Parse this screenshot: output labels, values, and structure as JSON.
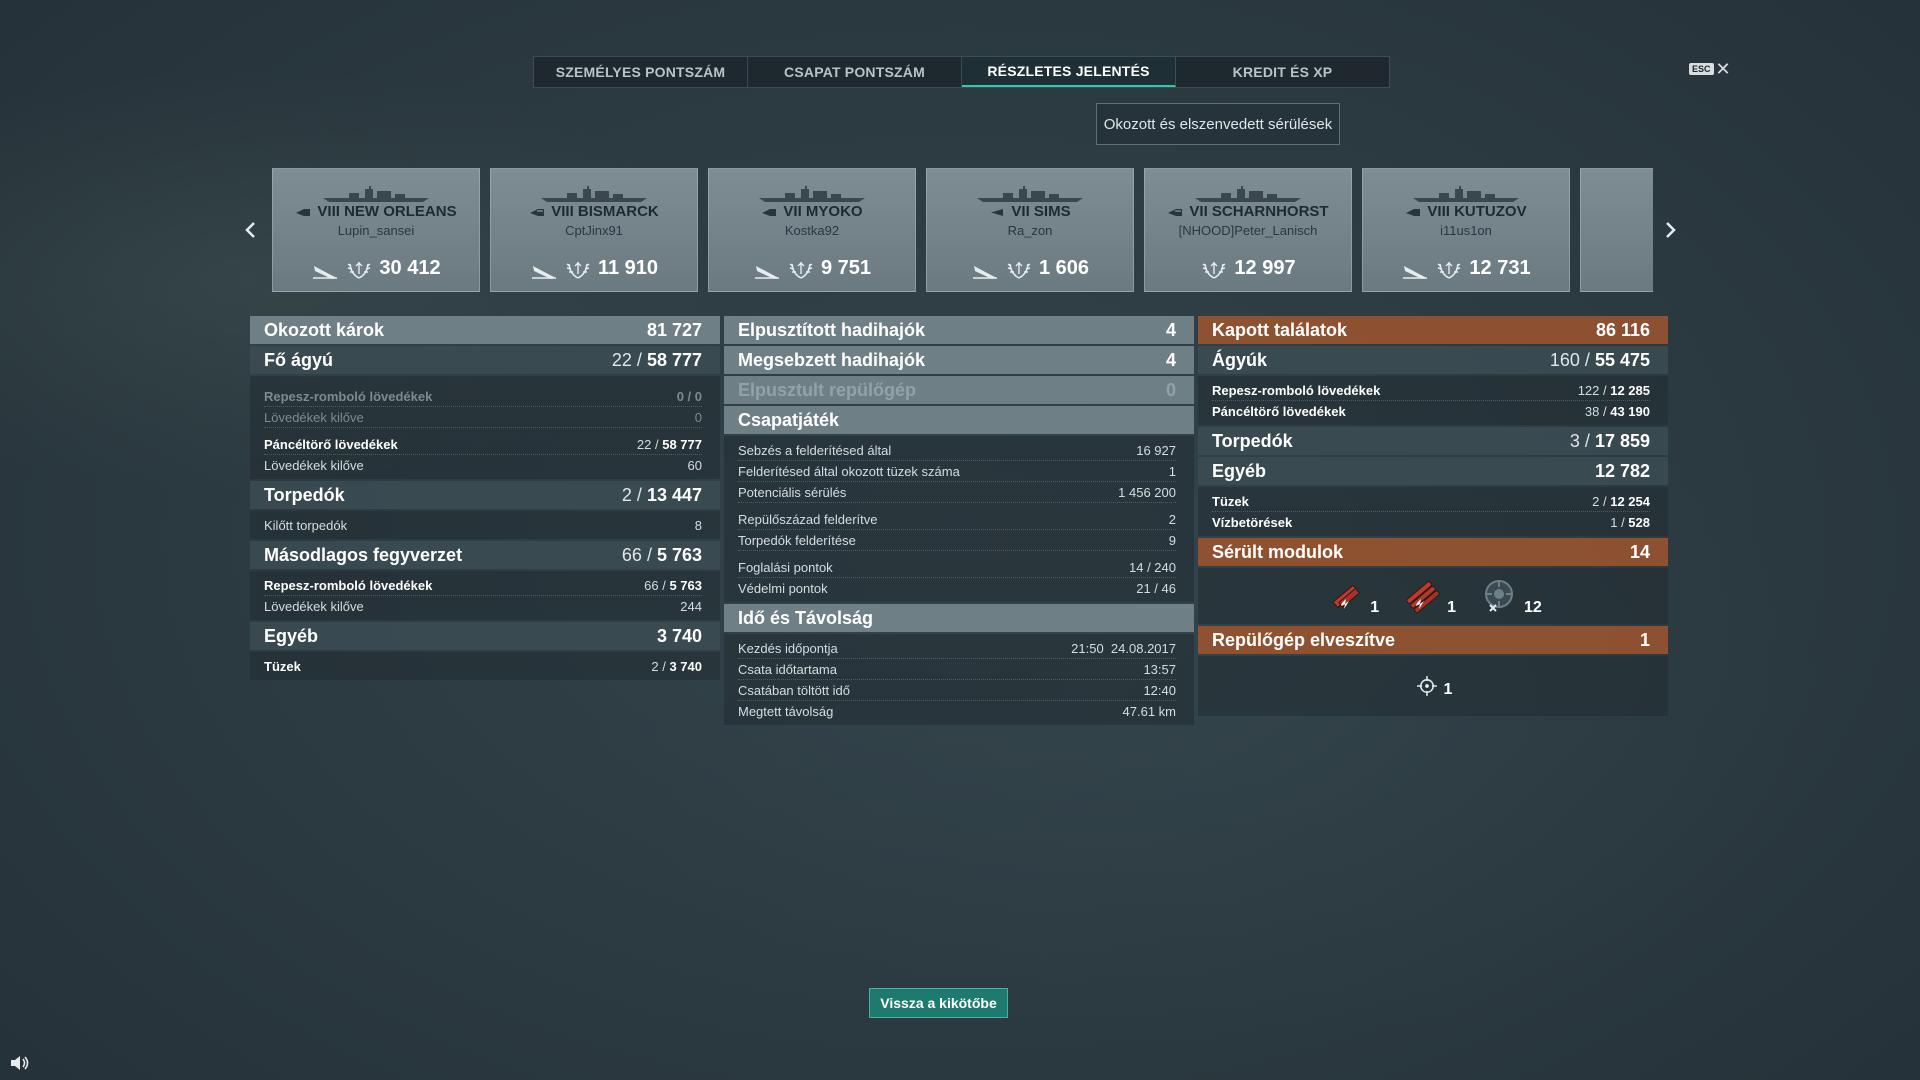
{
  "tabs": [
    "SZEMÉLYES PONTSZÁM",
    "CSAPAT PONTSZÁM",
    "RÉSZLETES JELENTÉS",
    "KREDIT ÉS XP"
  ],
  "active_tab": 2,
  "esc_label": "ESC",
  "damage_filter_button": "Okozott és elszenvedett sérülések",
  "ships": [
    {
      "name": "VIII NEW ORLEANS",
      "player": "Lupin_sansei",
      "score": "30 412",
      "type": "cruiser"
    },
    {
      "name": "VIII BISMARCK",
      "player": "CptJinx91",
      "score": "11 910",
      "type": "battleship"
    },
    {
      "name": "VII MYOKO",
      "player": "Kostka92",
      "score": "9 751",
      "type": "cruiser"
    },
    {
      "name": "VII SIMS",
      "player": "Ra_zon",
      "score": "1 606",
      "type": "destroyer"
    },
    {
      "name": "VII SCHARNHORST",
      "player": "[NHOOD]Peter_Lanisch",
      "score": "12 997",
      "type": "battleship"
    },
    {
      "name": "VIII KUTUZOV",
      "player": "i11us1on",
      "score": "12 731",
      "type": "cruiser"
    }
  ],
  "left": {
    "header": {
      "label": "Okozott károk",
      "value": "81 727"
    },
    "main_guns": {
      "label": "Fő ágyú",
      "hits": "22",
      "value": "58 777"
    },
    "he_shells": {
      "label": "Repesz-romboló lövedékek",
      "value": "0 / 0"
    },
    "he_fired": {
      "label": "Lövedékek kilőve",
      "value": "0"
    },
    "ap_shells": {
      "label": "Páncéltörő lövedékek",
      "hits": "22",
      "value": "58 777"
    },
    "ap_fired": {
      "label": "Lövedékek kilőve",
      "value": "60"
    },
    "torpedoes": {
      "label": "Torpedók",
      "hits": "2",
      "value": "13 447"
    },
    "torpedoes_fired": {
      "label": "Kilőtt torpedók",
      "value": "8"
    },
    "secondary": {
      "label": "Másodlagos fegyverzet",
      "hits": "66",
      "value": "5 763"
    },
    "sec_he": {
      "label": "Repesz-romboló lövedékek",
      "hits": "66",
      "value": "5 763"
    },
    "sec_fired": {
      "label": "Lövedékek kilőve",
      "value": "244"
    },
    "other": {
      "label": "Egyéb",
      "value": "3 740"
    },
    "fires": {
      "label": "Tüzek",
      "hits": "2",
      "value": "3 740"
    }
  },
  "middle": {
    "destroyed": {
      "label": "Elpusztított hadihajók",
      "value": "4"
    },
    "damaged": {
      "label": "Megsebzett hadihajók",
      "value": "4"
    },
    "planes": {
      "label": "Elpusztult repülőgép",
      "value": "0"
    },
    "teamplay": {
      "label": "Csapatjáték"
    },
    "spot_damage": {
      "label": "Sebzés a felderítésed által",
      "value": "16 927"
    },
    "spot_fires": {
      "label": "Felderítésed által okozott tüzek száma",
      "value": "1"
    },
    "potential": {
      "label": "Potenciális sérülés",
      "value": "1 456 200"
    },
    "squadrons": {
      "label": "Repülőszázad felderítve",
      "value": "2"
    },
    "torp_spotted": {
      "label": "Torpedók felderítése",
      "value": "9"
    },
    "capture": {
      "label": "Foglalási pontok",
      "value": "14 / 240"
    },
    "defense": {
      "label": "Védelmi pontok",
      "value": "21 / 46"
    },
    "time_distance": {
      "label": "Idő és Távolság"
    },
    "start_time": {
      "label": "Kezdés időpontja",
      "value": "21:50  24.08.2017"
    },
    "duration": {
      "label": "Csata időtartama",
      "value": "13:57"
    },
    "time_in_battle": {
      "label": "Csatában töltött idő",
      "value": "12:40"
    },
    "distance": {
      "label": "Megtett távolság",
      "value": "47.61 km"
    }
  },
  "right": {
    "header": {
      "label": "Kapott találatok",
      "value": "86 116"
    },
    "guns": {
      "label": "Ágyúk",
      "hits": "160",
      "value": "55 475"
    },
    "he": {
      "label": "Repesz-romboló lövedékek",
      "hits": "122",
      "value": "12 285"
    },
    "ap": {
      "label": "Páncéltörő lövedékek",
      "hits": "38",
      "value": "43 190"
    },
    "torpedoes": {
      "label": "Torpedók",
      "hits": "3",
      "value": "17 859"
    },
    "other": {
      "label": "Egyéb",
      "value": "12 782"
    },
    "fires": {
      "label": "Tüzek",
      "hits": "2",
      "value": "12 254"
    },
    "floods": {
      "label": "Vízbetörések",
      "hits": "1",
      "value": "528"
    },
    "modules": {
      "label": "Sérült modulok",
      "value": "14"
    },
    "module_counts": [
      "1",
      "1",
      "12"
    ],
    "planes_lost": {
      "label": "Repülőgép elveszítve",
      "value": "1",
      "icon_count": "1"
    }
  },
  "back_button": "Vissza a kikötőbe",
  "colors": {
    "accent": "#2fc6b4",
    "received_header": "#965430",
    "back_button": "#1e7a6f"
  }
}
